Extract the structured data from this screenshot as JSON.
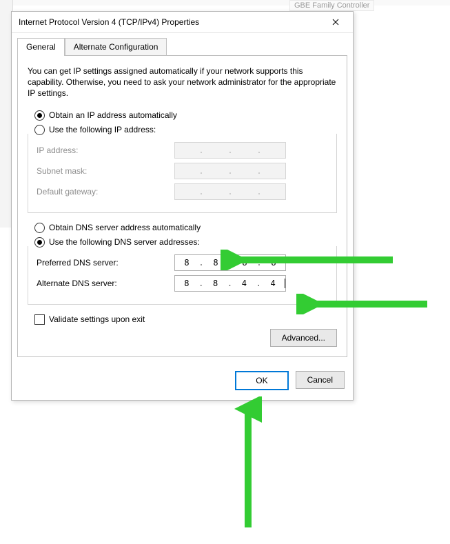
{
  "bg": {
    "hint_label": "GBE Family Controller"
  },
  "window": {
    "title": "Internet Protocol Version 4 (TCP/IPv4) Properties",
    "close_label": "Close"
  },
  "tabs": {
    "active": "General",
    "items": [
      "General",
      "Alternate Configuration"
    ]
  },
  "intro": "You can get IP settings assigned automatically if your network supports this capability. Otherwise, you need to ask your network administrator for the appropriate IP settings.",
  "ip_section": {
    "auto_label": "Obtain an IP address automatically",
    "manual_label": "Use the following IP address:",
    "selected": "auto",
    "fields": {
      "ip_label": "IP address:",
      "ip_value": [
        "",
        "",
        "",
        ""
      ],
      "mask_label": "Subnet mask:",
      "mask_value": [
        "",
        "",
        "",
        ""
      ],
      "gateway_label": "Default gateway:",
      "gateway_value": [
        "",
        "",
        "",
        ""
      ]
    }
  },
  "dns_section": {
    "auto_label": "Obtain DNS server address automatically",
    "manual_label": "Use the following DNS server addresses:",
    "selected": "manual",
    "preferred_label": "Preferred DNS server:",
    "preferred_value": [
      "8",
      "8",
      "8",
      "8"
    ],
    "alternate_label": "Alternate DNS server:",
    "alternate_value": [
      "8",
      "8",
      "4",
      "4"
    ]
  },
  "validate": {
    "label": "Validate settings upon exit",
    "checked": false
  },
  "advanced_label": "Advanced...",
  "buttons": {
    "ok": "OK",
    "cancel": "Cancel"
  },
  "colors": {
    "accent": "#0078d7",
    "arrow": "#33cc33"
  }
}
